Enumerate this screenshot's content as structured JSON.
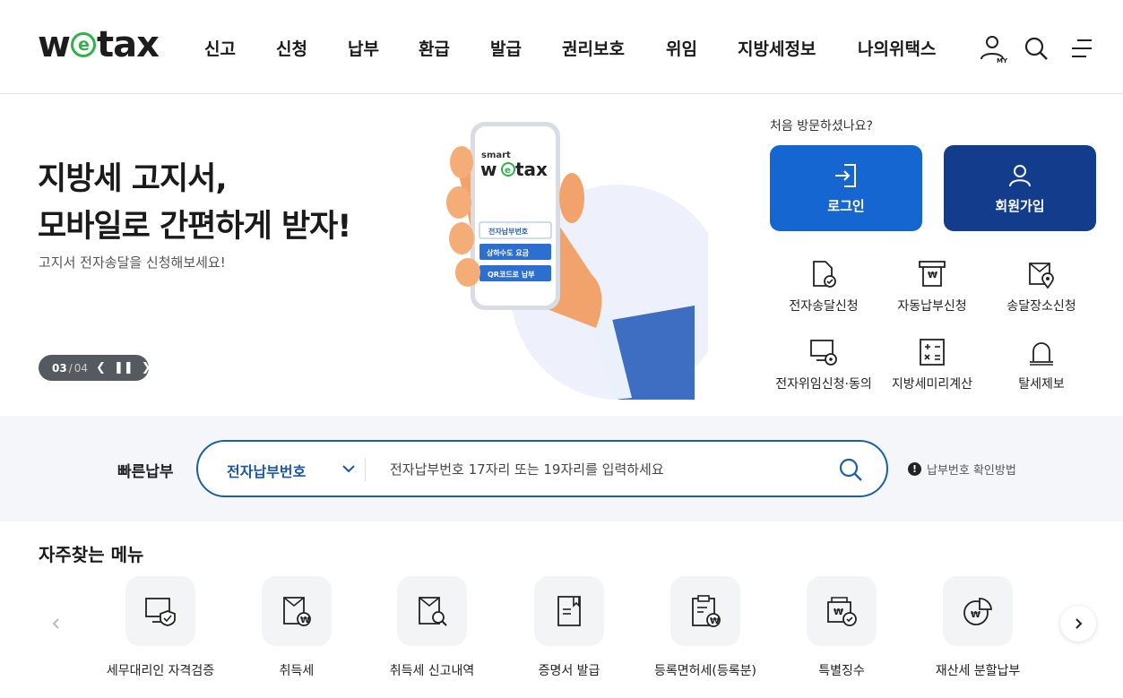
{
  "header": {
    "logo": {
      "pre": "w",
      "mid": "e",
      "post": "tax"
    },
    "nav": [
      "신고",
      "신청",
      "납부",
      "환급",
      "발급",
      "권리보호",
      "위임",
      "지방세정보",
      "나의위택스"
    ],
    "icons": {
      "my": "my-page-icon",
      "search": "search-icon",
      "menu": "hamburger-menu-icon"
    },
    "my_label": "MY"
  },
  "hero": {
    "title_line1": "지방세 고지서,",
    "title_line2": "모바일로 간편하게 받자!",
    "subtitle": "고지서 전자송달을 신청해보세요!",
    "pager": {
      "current": "03",
      "total": "04"
    },
    "phone": {
      "brand_small": "smart",
      "brand_pre": "w",
      "brand_mid": "e",
      "brand_post": "tax",
      "buttons": [
        "전자납부번호",
        "상하수도 요금",
        "QR코드로 납부"
      ]
    }
  },
  "side": {
    "first_visit": "처음 방문하셨나요?",
    "login": "로그인",
    "join": "회원가입",
    "quick": [
      {
        "label": "전자송달신청",
        "icon": "document-check-icon"
      },
      {
        "label": "자동납부신청",
        "icon": "auto-pay-icon"
      },
      {
        "label": "송달장소신청",
        "icon": "location-doc-icon"
      },
      {
        "label": "전자위임신청·동의",
        "icon": "monitor-lock-icon"
      },
      {
        "label": "지방세미리계산",
        "icon": "calculator-icon"
      },
      {
        "label": "탈세제보",
        "icon": "alarm-bell-icon"
      }
    ]
  },
  "quickpay": {
    "label": "빠른납부",
    "select_value": "전자납부번호",
    "placeholder": "전자납부번호 17자리 또는 19자리를 입력하세요",
    "howto": "납부번호 확인방법"
  },
  "freq": {
    "title": "자주찾는 메뉴",
    "items": [
      {
        "label": "세무대리인 자격검증",
        "icon": "monitor-shield-icon"
      },
      {
        "label": "취득세",
        "icon": "acquisition-tax-icon"
      },
      {
        "label": "취득세 신고내역",
        "icon": "doc-search-icon"
      },
      {
        "label": "증명서 발급",
        "icon": "certificate-icon"
      },
      {
        "label": "등록면허세(등록분)",
        "icon": "clipboard-won-icon"
      },
      {
        "label": "특별징수",
        "icon": "special-collection-icon"
      },
      {
        "label": "재산세 분할납부",
        "icon": "pie-chart-won-icon"
      }
    ]
  },
  "colors": {
    "accent": "#1666d1",
    "navy": "#133d8c",
    "brand_green": "#2fb24c",
    "border_blue": "#1a5fa8"
  }
}
